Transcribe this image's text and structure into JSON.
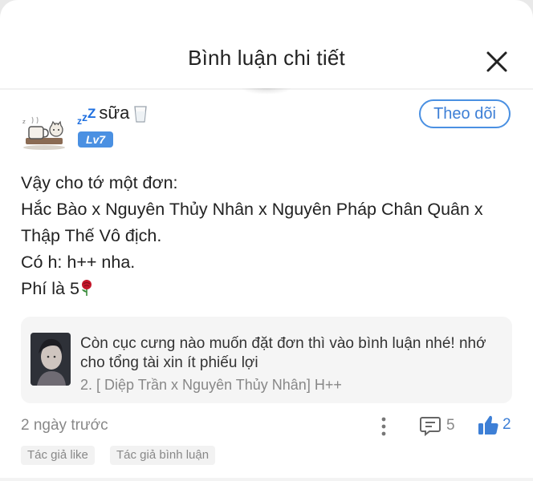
{
  "header": {
    "title": "Bình luận chi tiết"
  },
  "user": {
    "name": "sữa",
    "zz": [
      "z",
      "z",
      "Z"
    ],
    "level": "Lv7"
  },
  "follow_label": "Theo dõi",
  "comment": {
    "lines": [
      "Vậy cho tớ một đơn:",
      "Hắc Bào x Nguyên Thủy Nhân x Nguyên Pháp Chân Quân x",
      "Thập Thế Vô địch.",
      "Có h: h++ nha.",
      "Phí là 5"
    ]
  },
  "quote": {
    "text": "Còn cục cưng nào muốn đặt đơn thì vào bình luận nhé! nhớ cho tổng tài xin ít phiếu lợi",
    "sub": "2. [ Diệp Trần x Nguyên Thủy Nhân] H++"
  },
  "footer": {
    "time": "2 ngày trước",
    "comment_count": "5",
    "like_count": "2",
    "tags": [
      "Tác giả like",
      "Tác giả bình luận"
    ]
  },
  "icons": [
    "close-icon",
    "milk-icon",
    "rose-icon",
    "more-vertical-icon",
    "comment-icon",
    "thumbs-up-icon"
  ],
  "colors": {
    "accent": "#4a90e2",
    "like": "#3d7fd6"
  }
}
